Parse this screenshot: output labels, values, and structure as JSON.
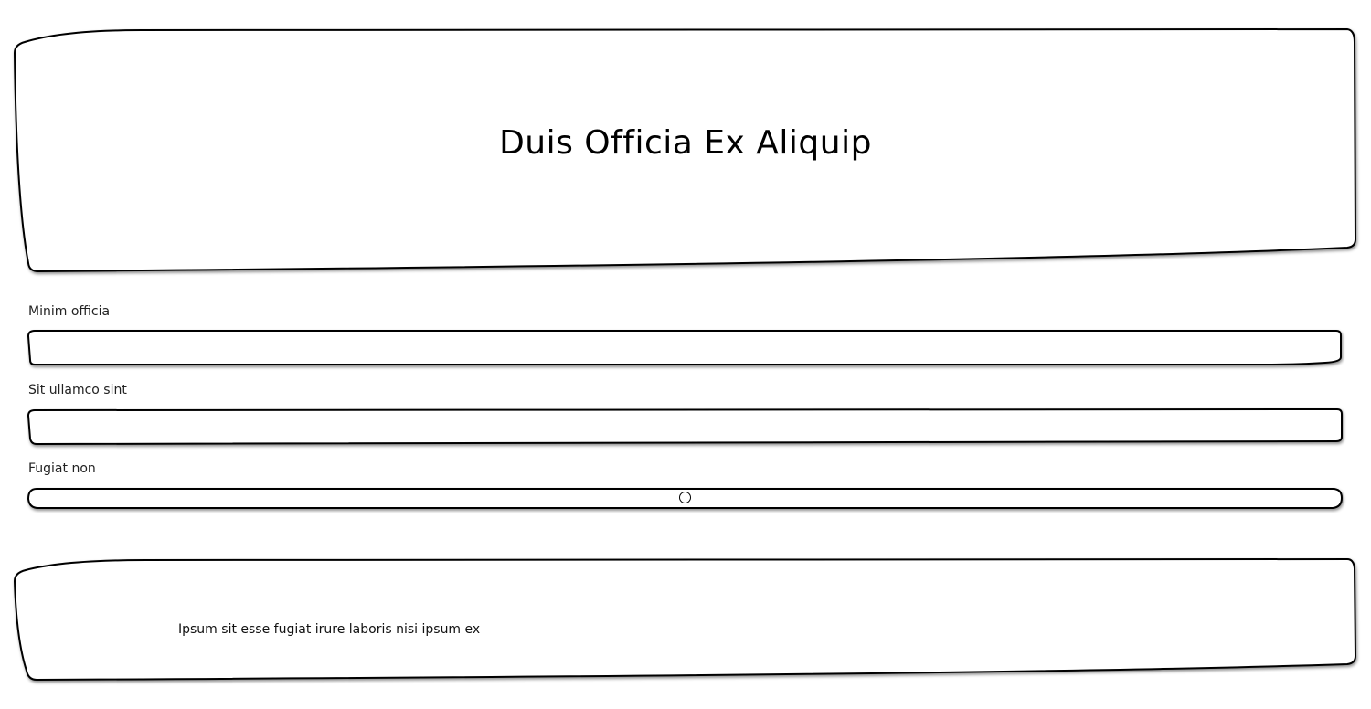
{
  "header": {
    "title": "Duis Officia Ex Aliquip"
  },
  "form": {
    "field1": {
      "label": "Minim officia",
      "value": ""
    },
    "field2": {
      "label": "Sit ullamco sint",
      "value": ""
    },
    "slider": {
      "label": "Fugiat non",
      "value_percent": 50
    }
  },
  "footer": {
    "text": "Ipsum sit esse fugiat irure laboris nisi ipsum ex"
  }
}
